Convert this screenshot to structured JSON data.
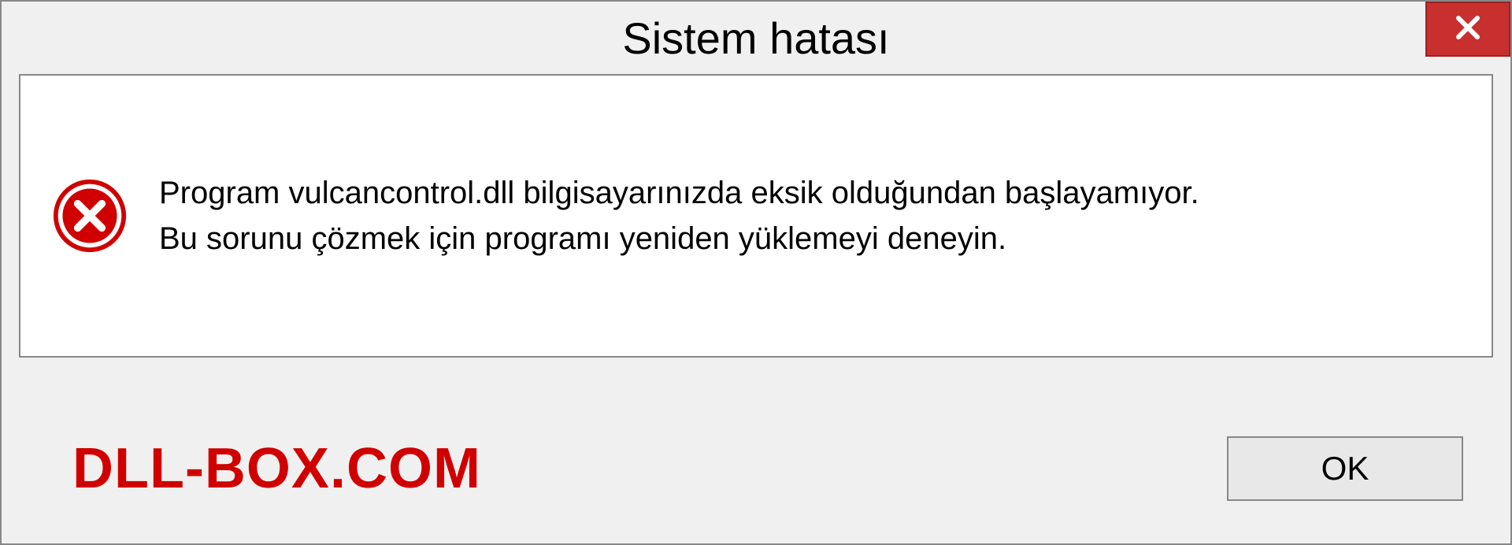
{
  "dialog": {
    "title": "Sistem hatası",
    "message_line1": "Program vulcancontrol.dll bilgisayarınızda eksik olduğundan başlayamıyor.",
    "message_line2": "Bu sorunu çözmek için programı yeniden yüklemeyi deneyin.",
    "ok_label": "OK",
    "watermark": "DLL-BOX.COM"
  }
}
